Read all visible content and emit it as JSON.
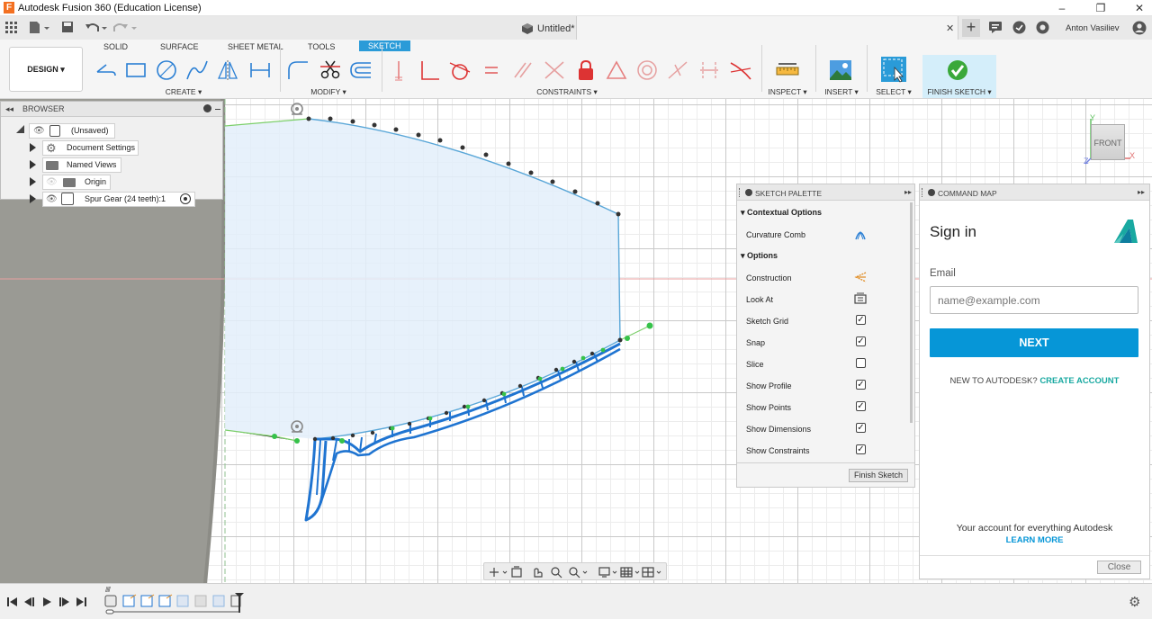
{
  "window": {
    "title": "Autodesk Fusion 360 (Education License)",
    "minimize": "–",
    "restore": "❐",
    "close": "✕",
    "logo": "F"
  },
  "doc_tab": {
    "title": "Untitled*",
    "close": "✕",
    "add": "+",
    "user": "Anton Vasiliev"
  },
  "ribbon": {
    "tabs": [
      "SOLID",
      "SURFACE",
      "SHEET METAL",
      "TOOLS",
      "SKETCH"
    ],
    "design_label": "DESIGN ▾",
    "groups": {
      "create": "CREATE ▾",
      "modify": "MODIFY ▾",
      "constraints": "CONSTRAINTS ▾",
      "inspect": "INSPECT ▾",
      "insert": "INSERT ▾",
      "select": "SELECT ▾",
      "finish": "FINISH SKETCH ▾"
    }
  },
  "browser": {
    "header": "BROWSER",
    "items": [
      {
        "label": "(Unsaved)",
        "icon": "document-icon"
      },
      {
        "label": "Document Settings",
        "icon": "gear-icon"
      },
      {
        "label": "Named Views",
        "icon": "folder-icon"
      },
      {
        "label": "Origin",
        "icon": "folder-icon"
      },
      {
        "label": "Spur Gear (24 teeth):1",
        "icon": "component-icon"
      }
    ]
  },
  "viewcube": {
    "face": "FRONT",
    "x_axis": "X",
    "y_axis": "Y",
    "z_axis": "Z"
  },
  "palette": {
    "header": "SKETCH PALETTE",
    "contextual_header": "Contextual Options",
    "curvature_comb": "Curvature Comb",
    "options_header": "Options",
    "options": [
      {
        "label": "Construction",
        "type": "icon"
      },
      {
        "label": "Look At",
        "type": "icon"
      },
      {
        "label": "Sketch Grid",
        "checked": true
      },
      {
        "label": "Snap",
        "checked": true
      },
      {
        "label": "Slice",
        "checked": false
      },
      {
        "label": "Show Profile",
        "checked": true
      },
      {
        "label": "Show Points",
        "checked": true
      },
      {
        "label": "Show Dimensions",
        "checked": true
      },
      {
        "label": "Show Constraints",
        "checked": true
      }
    ],
    "finish_button": "Finish Sketch"
  },
  "command_map": {
    "header": "COMMAND MAP",
    "sign_in": "Sign in",
    "email_label": "Email",
    "email_placeholder": "name@example.com",
    "next": "NEXT",
    "new_to": "NEW TO AUTODESK?",
    "create_account": "CREATE ACCOUNT",
    "tagline": "Your account for everything Autodesk",
    "learn_more": "LEARN MORE",
    "close": "Close"
  },
  "colors": {
    "accent": "#2a9bd8",
    "profile_fill": "#e6f1fb",
    "curve": "#1f74d1",
    "autodesk_teal": "#19a9a1",
    "next_btn": "#0696d7"
  }
}
